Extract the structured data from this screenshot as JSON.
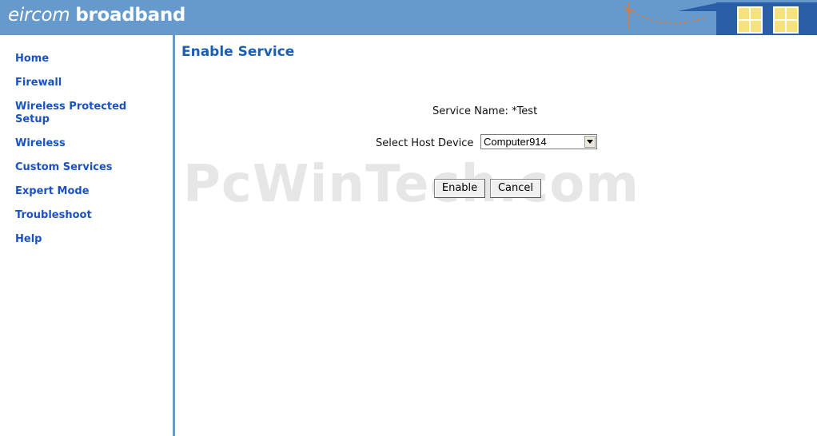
{
  "header": {
    "brand_light": "eircom",
    "brand_bold": "broadband"
  },
  "sidebar": {
    "items": [
      {
        "label": "Home"
      },
      {
        "label": "Firewall"
      },
      {
        "label": "Wireless Protected Setup"
      },
      {
        "label": "Wireless"
      },
      {
        "label": "Custom Services"
      },
      {
        "label": "Expert Mode"
      },
      {
        "label": "Troubleshoot"
      },
      {
        "label": "Help"
      }
    ]
  },
  "main": {
    "title": "Enable Service",
    "service_name_label": "Service Name:",
    "service_name_value": "*Test",
    "host_label": "Select Host Device",
    "host_selected": "Computer914",
    "enable_label": "Enable",
    "cancel_label": "Cancel",
    "watermark": "PcWinTech.com"
  },
  "colors": {
    "header_bg": "#6699cc",
    "nav_link": "#1a52c4",
    "title": "#1a5fb4"
  }
}
